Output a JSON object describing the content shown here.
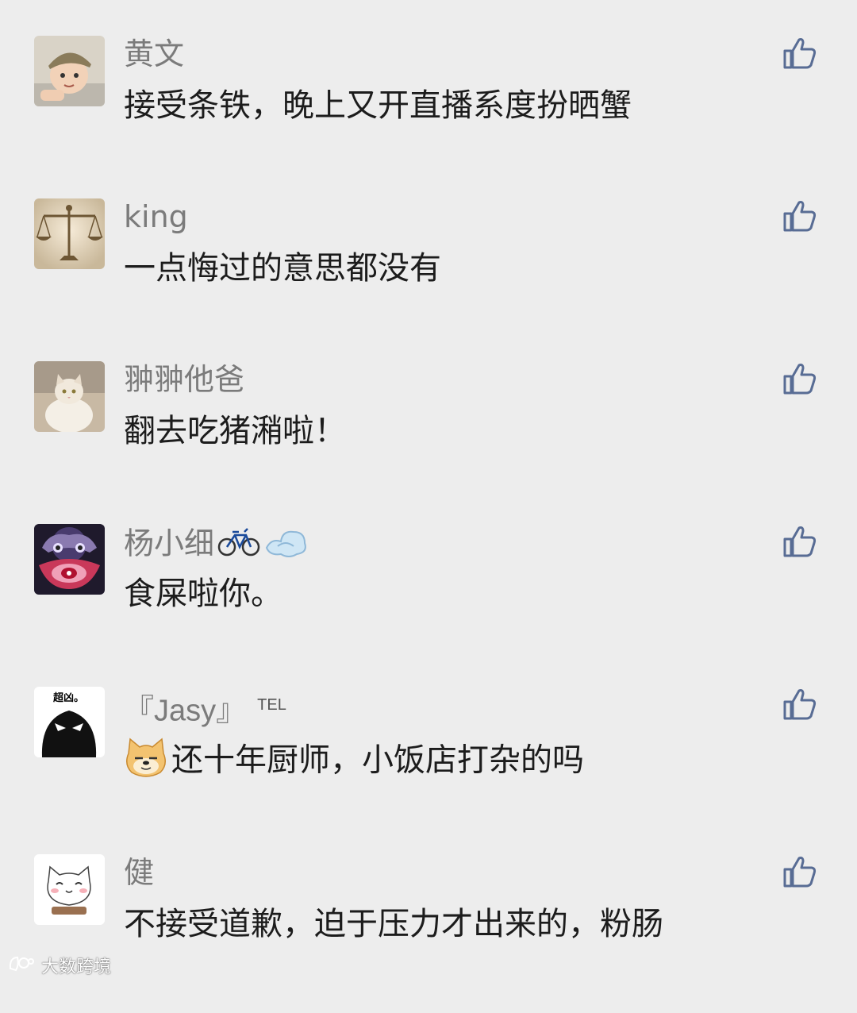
{
  "comments": [
    {
      "name": "黄文",
      "text": "接受条铁，晚上又开直播系度扮晒蟹",
      "avatar": "baby-avatar",
      "like_icon": "thumbs-up-icon"
    },
    {
      "name": "king",
      "text": "一点悔过的意思都没有",
      "avatar": "scales-avatar",
      "like_icon": "thumbs-up-icon"
    },
    {
      "name": "翀翀他爸",
      "text": "翻去吃猪潲啦！",
      "avatar": "cat-avatar",
      "like_icon": "thumbs-up-icon"
    },
    {
      "name": "杨小细",
      "name_emojis": [
        "bicycle-emoji",
        "dash-emoji"
      ],
      "text": "食屎啦你。",
      "avatar": "lion-dance-avatar",
      "like_icon": "thumbs-up-icon"
    },
    {
      "name": "『Jasy』",
      "name_badge": "TEL",
      "text_emoji": "doge-emoji",
      "text": "还十年厨师，小饭店打杂的吗",
      "avatar": "chaoxiong-avatar",
      "avatar_text": "超凶。",
      "like_icon": "thumbs-up-icon"
    },
    {
      "name": "健",
      "text": "不接受道歉，迫于压力才出来的，粉肠",
      "avatar": "white-cat-avatar",
      "like_icon": "thumbs-up-icon"
    }
  ],
  "watermark": {
    "text": "大数跨境",
    "icon": "brand-logo-icon"
  },
  "colors": {
    "background": "#ededed",
    "name": "#7b7b7b",
    "text": "#1c1c1c",
    "like": "#586c94"
  }
}
